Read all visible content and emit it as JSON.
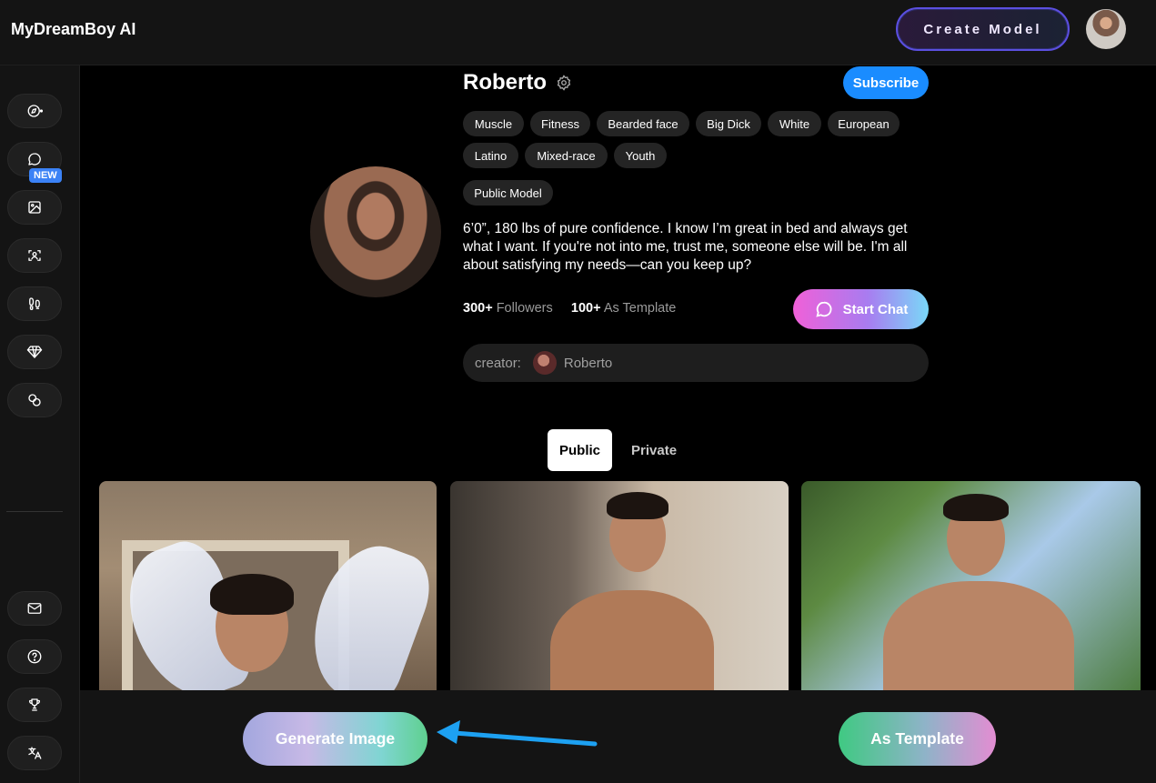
{
  "header": {
    "logo": "MyDreamBoy AI",
    "create_model_label": "Create Model"
  },
  "sidebar": {
    "items": [
      {
        "icon": "compass-icon"
      },
      {
        "icon": "chat-bubble-icon"
      },
      {
        "icon": "image-icon"
      },
      {
        "icon": "face-scan-icon",
        "badge": "NEW"
      },
      {
        "icon": "footprints-icon"
      },
      {
        "icon": "diamond-icon"
      },
      {
        "icon": "coins-icon"
      }
    ],
    "bottom_items": [
      {
        "icon": "mail-icon"
      },
      {
        "icon": "help-icon"
      },
      {
        "icon": "trophy-icon"
      },
      {
        "icon": "translate-icon"
      }
    ]
  },
  "profile": {
    "name": "Roberto",
    "subscribe_label": "Subscribe",
    "tags": [
      "Muscle",
      "Fitness",
      "Bearded face",
      "Big Dick",
      "White",
      "European",
      "Latino",
      "Mixed-race",
      "Youth"
    ],
    "model_type": "Public Model",
    "description": "6’0”, 180 lbs of pure confidence. I know I’m great in bed and always get what I want. If you're not into me, trust me, someone else will be. I'm all about satisfying my needs—can you keep up?",
    "followers_count": "300+",
    "followers_label": "Followers",
    "template_count": "100+",
    "template_label": "As Template",
    "start_chat_label": "Start Chat",
    "creator_label": "creator:",
    "creator_name": "Roberto"
  },
  "tabs": {
    "public": "Public",
    "private": "Private"
  },
  "actions": {
    "generate_image": "Generate Image",
    "as_template": "As Template"
  },
  "colors": {
    "subscribe": "#1a8cff",
    "new_badge": "#3b82f6",
    "arrow": "#1da1f2"
  }
}
